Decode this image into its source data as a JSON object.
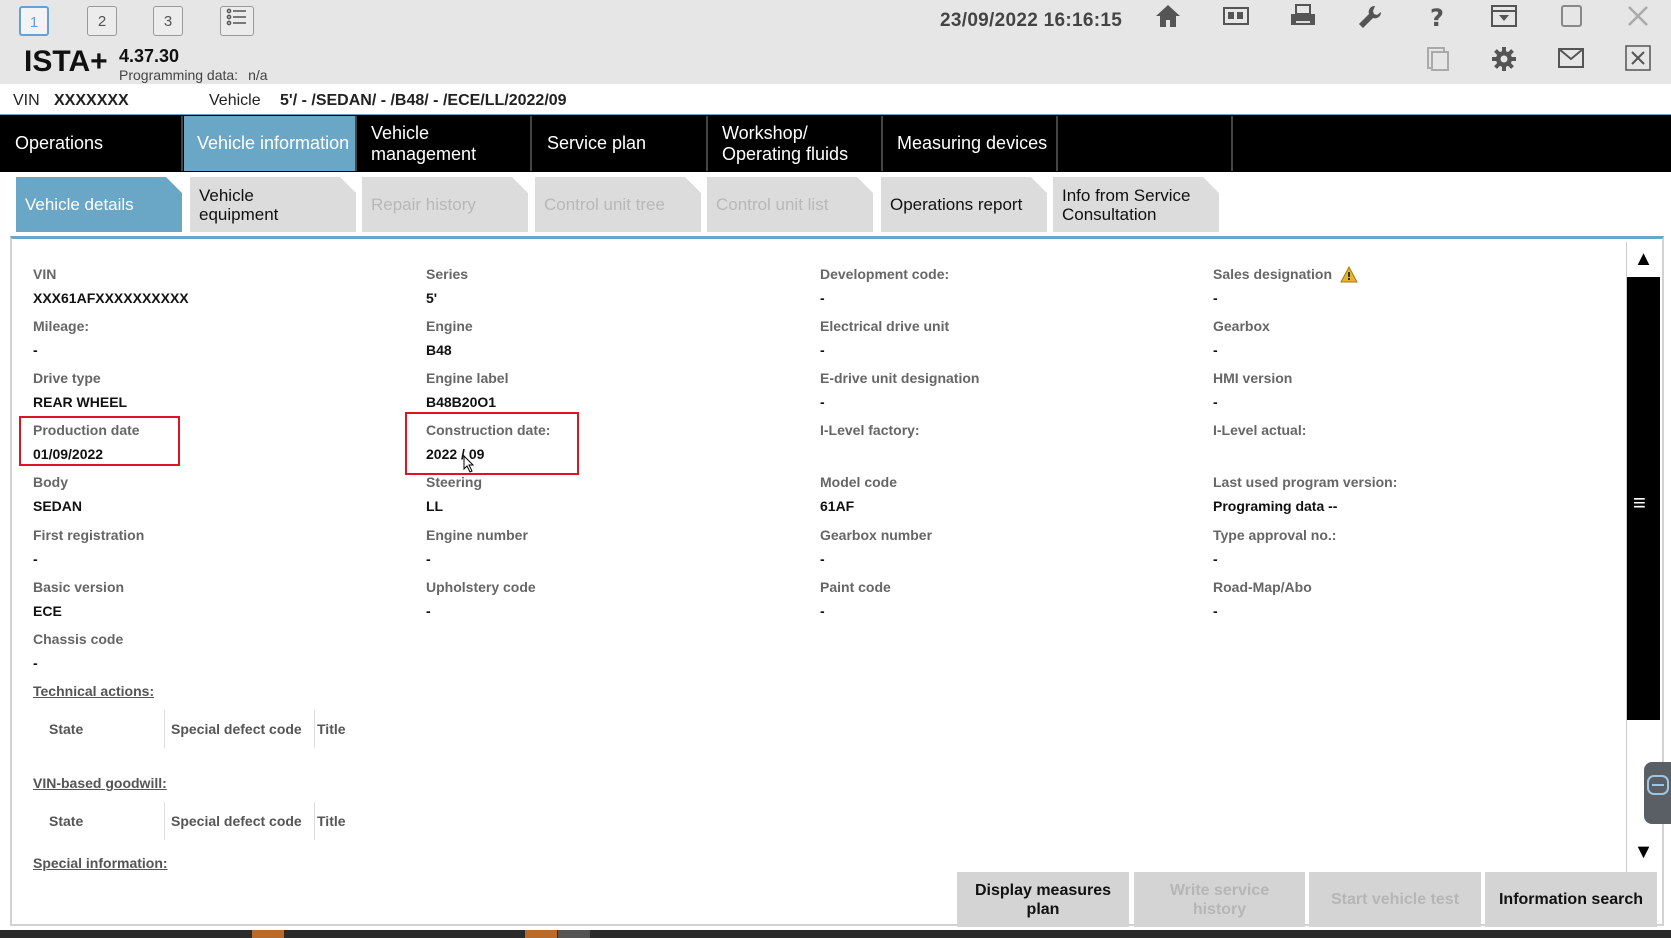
{
  "topbar": {
    "sessions": [
      "1",
      "2",
      "3"
    ],
    "list_icon": "list-icon",
    "datetime": "23/09/2022 16:16:15",
    "icons": [
      "home-icon",
      "cards-icon",
      "print-icon",
      "wrench-icon",
      "help-icon",
      "window-dropdown-icon",
      "restore-window-icon",
      "close-icon"
    ]
  },
  "app": {
    "name": "ISTA+",
    "version": "4.37.30",
    "programming_label": "Programming data:",
    "programming_value": "n/a",
    "icons": [
      "copy-icon",
      "gear-icon",
      "mail-icon",
      "close-icon"
    ]
  },
  "vinline": {
    "vin_label": "VIN",
    "vin_value": "XXXXXXX",
    "vehicle_label": "Vehicle",
    "vehicle_value": "5'/ - /SEDAN/ - /B48/ - /ECE/LL/2022/09"
  },
  "mainnav": [
    "Operations",
    "Vehicle information",
    "Vehicle management",
    "Service plan",
    "Workshop/ Operating fluids",
    "Measuring devices",
    ""
  ],
  "subtabs": [
    "Vehicle details",
    "Vehicle equipment",
    "Repair history",
    "Control unit tree",
    "Control unit list",
    "Operations report",
    "Info from Service Consultation"
  ],
  "details": {
    "col1": [
      {
        "label": "VIN",
        "value": "XXX61AFXXXXXXXXXX"
      },
      {
        "label": "Mileage:",
        "value": "-"
      },
      {
        "label": "Drive type",
        "value": "REAR WHEEL"
      },
      {
        "label": "Production date",
        "value": "01/09/2022"
      },
      {
        "label": "Body",
        "value": "SEDAN"
      },
      {
        "label": "First registration",
        "value": "-"
      },
      {
        "label": "Basic version",
        "value": "ECE"
      },
      {
        "label": "Chassis code",
        "value": "-"
      }
    ],
    "col2": [
      {
        "label": "Series",
        "value": "5'"
      },
      {
        "label": "Engine",
        "value": "B48"
      },
      {
        "label": "Engine label",
        "value": "B48B20O1"
      },
      {
        "label": "Construction date:",
        "value": "2022 / 09"
      },
      {
        "label": "Steering",
        "value": "LL"
      },
      {
        "label": "Engine number",
        "value": "-"
      },
      {
        "label": "Upholstery code",
        "value": "-"
      }
    ],
    "col3": [
      {
        "label": "Development code:",
        "value": "-"
      },
      {
        "label": "Electrical drive unit",
        "value": "-"
      },
      {
        "label": "E-drive unit designation",
        "value": "-"
      },
      {
        "label": "I-Level factory:",
        "value": ""
      },
      {
        "label": "Model code",
        "value": "61AF"
      },
      {
        "label": "Gearbox number",
        "value": "-"
      },
      {
        "label": "Paint code",
        "value": "-"
      }
    ],
    "col4": [
      {
        "label": "Sales designation",
        "value": "-"
      },
      {
        "label": "Gearbox",
        "value": "-"
      },
      {
        "label": "HMI version",
        "value": "-"
      },
      {
        "label": "I-Level actual:",
        "value": ""
      },
      {
        "label": "Last used program version:",
        "value": "Programing data --"
      },
      {
        "label": "Type approval no.:",
        "value": "-"
      },
      {
        "label": "Road-Map/Abo",
        "value": "-"
      }
    ]
  },
  "sections": {
    "technical_actions": "Technical actions:",
    "vin_goodwill": "VIN-based goodwill:",
    "special_info": "Special information:",
    "table_headers": [
      "State",
      "Special defect code",
      "Title"
    ]
  },
  "bottom_buttons": [
    "Display measures plan",
    "Write service history",
    "Start vehicle test",
    "Information search"
  ],
  "colors": {
    "accent": "#6aa6c6",
    "highlight": "#e0141e",
    "nav_bg": "#000000"
  }
}
